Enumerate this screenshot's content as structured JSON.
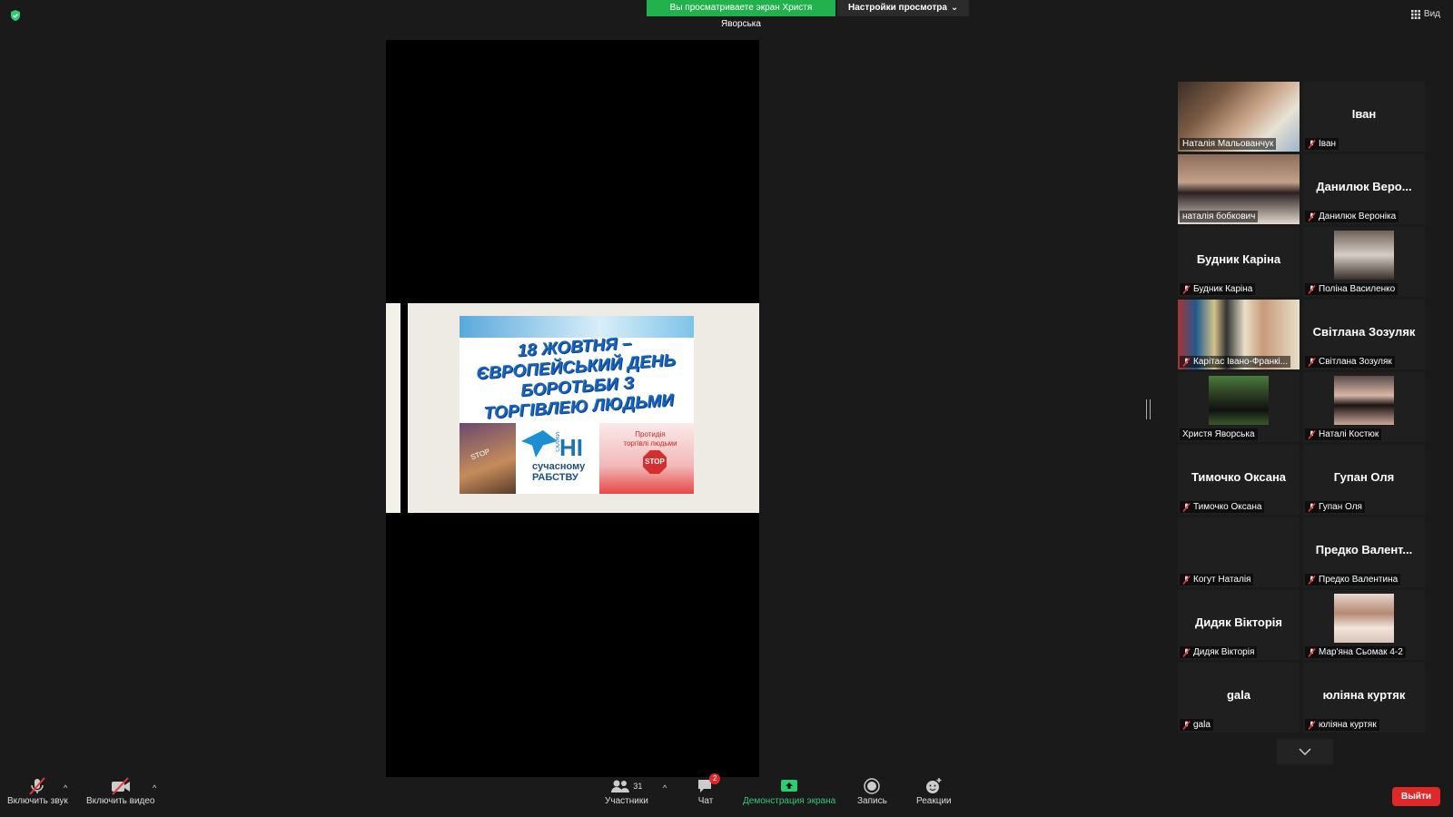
{
  "banner": {
    "viewing_text": "Вы просматриваете экран Христя Яворська",
    "view_settings_label": "Настройки просмотра"
  },
  "view_button_label": "Вид",
  "slide": {
    "title_lines": [
      "18  ЖОВТНЯ –",
      "ЄВРОПЕЙСЬКИЙ ДЕНЬ",
      "БОРОТЬБИ З",
      "ТОРГІВЛЕЮ ЛЮДЬМИ"
    ],
    "panel2_ni": "НІ",
    "panel2_skazhy": "СКАЖИ",
    "panel2_sub": "сучасному\nРАБСТВУ",
    "panel3_text": "Протидія\nторгівлі людьми",
    "panel3_stop": "STOP",
    "panel1_stop": "STOP"
  },
  "participants": [
    {
      "display": "",
      "label": "Наталія Мальованчук",
      "muted": false,
      "video": true,
      "active": true
    },
    {
      "display": "Іван",
      "label": "Іван",
      "muted": true,
      "video": false
    },
    {
      "display": "",
      "label": "наталія бобкович",
      "muted": false,
      "video": true
    },
    {
      "display": "Данилюк  Веро...",
      "label": "Данилюк Вероніка",
      "muted": true,
      "video": false
    },
    {
      "display": "Будник Каріна",
      "label": "Будник Каріна",
      "muted": true,
      "video": false
    },
    {
      "display": "",
      "label": "Поліна Василенко",
      "muted": true,
      "video": true
    },
    {
      "display": "",
      "label": "Карітас Івано-Франкі...",
      "muted": true,
      "video": true
    },
    {
      "display": "Світлана Зозуляк",
      "label": "Світлана Зозуляк",
      "muted": true,
      "video": false
    },
    {
      "display": "",
      "label": "Христя Яворська",
      "muted": false,
      "video": true
    },
    {
      "display": "",
      "label": "Наталі Костюк",
      "muted": true,
      "video": true
    },
    {
      "display": "Тимочко Оксана",
      "label": "Тимочко Оксана",
      "muted": true,
      "video": false
    },
    {
      "display": "Гупан Оля",
      "label": "Гупан Оля",
      "muted": true,
      "video": false
    },
    {
      "display": "",
      "label": "Когут Наталія",
      "muted": true,
      "video": false
    },
    {
      "display": "Предко  Валент...",
      "label": "Предко Валентина",
      "muted": true,
      "video": false
    },
    {
      "display": "Дидяк Вікторія",
      "label": "Дидяк Вікторія",
      "muted": true,
      "video": false
    },
    {
      "display": "",
      "label": "Мар'яна Сьомак 4-2",
      "muted": true,
      "video": true
    },
    {
      "display": "gala",
      "label": "gala",
      "muted": true,
      "video": false
    },
    {
      "display": "юліяна куртяк",
      "label": "юліяна куртяк",
      "muted": true,
      "video": false
    }
  ],
  "toolbar": {
    "unmute_label": "Включить звук",
    "start_video_label": "Включить видео",
    "participants_label": "Участники",
    "participants_count": "31",
    "chat_label": "Чат",
    "chat_badge": "2",
    "share_label": "Демонстрация экрана",
    "record_label": "Запись",
    "reactions_label": "Реакции",
    "leave_label": "Выйти"
  },
  "colors": {
    "share_banner": "#22b14c",
    "active_speaker": "#e6e600",
    "leave": "#e02828",
    "mute_icon": "#e53935"
  }
}
